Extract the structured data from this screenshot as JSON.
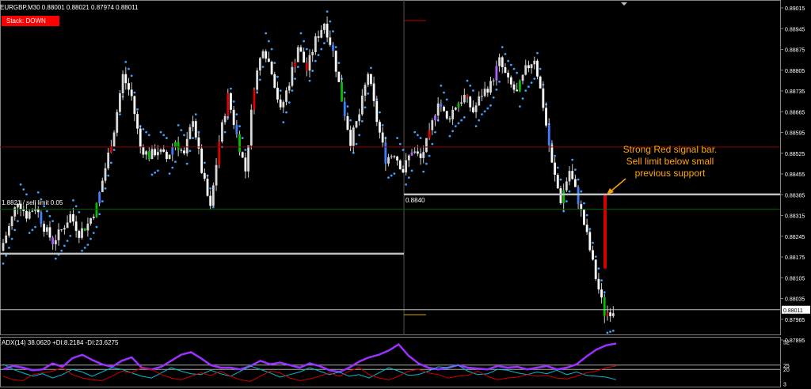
{
  "header": {
    "symbol_line": "EURGBP,M30  0.88001 0.88021 0.87974 0.88011",
    "status_badge": "Stack: DOWN",
    "badge_color": "#ff0000"
  },
  "annotation": {
    "lines": [
      "Strong Red signal bar.",
      "Sell limit below small",
      "previous support"
    ],
    "color": "#ffa500"
  },
  "chart_data": [
    {
      "type": "candlestick",
      "symbol": "EURGBP",
      "timeframe": "M30",
      "ohlc_current": {
        "open": 0.88001,
        "high": 0.88021,
        "low": 0.87974,
        "close": 0.88011
      },
      "current_price_label": "0.88011",
      "ylim": [
        0.87925,
        0.89045
      ],
      "y_ticks": [
        "0.89015",
        "0.88945",
        "0.88875",
        "0.88805",
        "0.88735",
        "0.88665",
        "0.88595",
        "0.88525",
        "0.88455",
        "0.88385",
        "0.88315",
        "0.88245",
        "0.88175",
        "0.88105",
        "0.88035",
        "0.87965",
        "0.87895"
      ],
      "price_close_path": [
        0.8821,
        0.8829,
        0.8838,
        0.8833,
        0.8836,
        0.8829,
        0.8824,
        0.8828,
        0.8833,
        0.8827,
        0.883,
        0.8836,
        0.8849,
        0.8862,
        0.888,
        0.8873,
        0.8856,
        0.8853,
        0.8855,
        0.8852,
        0.8858,
        0.8853,
        0.8866,
        0.8848,
        0.8835,
        0.8858,
        0.8873,
        0.886,
        0.8848,
        0.8877,
        0.889,
        0.8882,
        0.8868,
        0.8878,
        0.889,
        0.8882,
        0.8892,
        0.8898,
        0.8888,
        0.8872,
        0.8858,
        0.8867,
        0.8881,
        0.8865,
        0.8852,
        0.8854,
        0.8848,
        0.8855,
        0.8852,
        0.886,
        0.8872,
        0.8865,
        0.887,
        0.8873,
        0.8868,
        0.8874,
        0.8877,
        0.8885,
        0.8878,
        0.8874,
        0.8882,
        0.8886,
        0.887,
        0.885,
        0.8838,
        0.8848,
        0.8838,
        0.8826,
        0.8812,
        0.88,
        0.8801
      ],
      "horizontal_levels": [
        {
          "price": 0.8856,
          "color": "#8b0000"
        },
        {
          "price": 0.8835,
          "color": "#006400"
        },
        {
          "price": 0.884,
          "color": "#c0c0c0",
          "label": "0.8840"
        },
        {
          "price": 0.882,
          "color": "#c0c0c0"
        },
        {
          "price": 0.88011,
          "color": "#c0c0c0"
        }
      ],
      "left_level_label": "1.8821 / sell limit 0.05",
      "signal_bar": {
        "color": "#d00000",
        "open": 0.884,
        "close": 0.8815
      }
    },
    {
      "type": "line",
      "title": "ADX(14) 38.0620 +DI:8.2184 -DI:23.6275",
      "y_ticks": [
        "52",
        "25",
        "20",
        "3"
      ],
      "series": [
        {
          "name": "ADX",
          "color": "#9b30ff",
          "values": [
            20,
            24,
            22,
            19,
            20,
            27,
            23,
            33,
            37,
            31,
            26,
            23,
            30,
            34,
            22,
            20,
            23,
            30,
            37,
            40,
            33,
            25,
            22,
            22,
            20,
            24,
            30,
            26,
            28,
            25,
            22,
            27,
            24,
            19,
            17,
            22,
            29,
            34,
            37,
            42,
            49,
            36,
            27,
            22,
            20,
            22,
            25,
            22,
            21,
            20,
            24,
            22,
            23,
            20,
            22,
            24,
            20,
            22,
            26,
            35,
            43,
            48,
            50
          ]
        },
        {
          "name": "+DI",
          "color": "#00bcd4",
          "values": [
            26,
            20,
            16,
            12,
            15,
            10,
            14,
            20,
            17,
            12,
            17,
            22,
            20,
            16,
            12,
            10,
            16,
            22,
            18,
            15,
            14,
            19,
            15,
            12,
            18,
            24,
            20,
            16,
            11,
            14,
            17,
            22,
            18,
            14,
            17,
            12,
            14,
            10,
            16,
            22,
            18,
            13,
            14,
            18,
            23,
            22,
            25,
            18,
            14,
            15,
            20,
            19,
            16,
            14,
            17,
            15,
            19,
            14,
            17,
            13,
            12,
            11,
            8
          ]
        },
        {
          "name": "-DI",
          "color": "#d00000",
          "values": [
            12,
            8,
            7,
            14,
            16,
            18,
            22,
            14,
            10,
            8,
            7,
            12,
            18,
            16,
            22,
            20,
            14,
            10,
            8,
            12,
            16,
            13,
            18,
            12,
            8,
            6,
            12,
            18,
            16,
            10,
            7,
            9,
            12,
            16,
            12,
            18,
            22,
            14,
            10,
            8,
            12,
            18,
            20,
            16,
            14,
            10,
            12,
            13,
            18,
            12,
            8,
            10,
            11,
            14,
            12,
            13,
            10,
            9,
            12,
            16,
            18,
            22,
            24
          ]
        }
      ]
    }
  ]
}
